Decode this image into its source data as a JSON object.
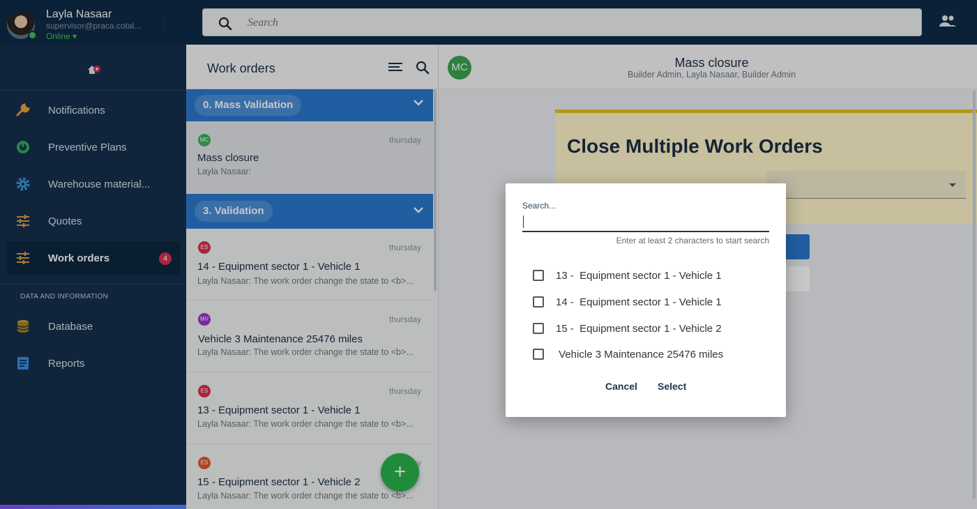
{
  "profile": {
    "name": "Layla Nasaar",
    "email": "supervisor@praca.cotal...",
    "status": "Online ▾"
  },
  "topbar": {
    "search_placeholder": "Search"
  },
  "sidebar": {
    "items": [
      {
        "label": "Notifications",
        "icon": "wrench-icon"
      },
      {
        "label": "Preventive Plans",
        "icon": "gauge-icon"
      },
      {
        "label": "Warehouse material...",
        "icon": "gear-icon"
      },
      {
        "label": "Quotes",
        "icon": "sliders-icon"
      },
      {
        "label": "Work orders",
        "icon": "sliders-icon",
        "badge": "4",
        "active": true
      }
    ],
    "section_title": "DATA AND INFORMATION",
    "section_items": [
      {
        "label": "Database",
        "icon": "database-icon"
      },
      {
        "label": "Reports",
        "icon": "report-icon"
      }
    ]
  },
  "work_orders": {
    "title": "Work orders",
    "groups": [
      {
        "label": "0. Mass Validation"
      },
      {
        "label": "3. Validation"
      }
    ],
    "cards": [
      {
        "initials": "MC",
        "color": "#3fb05a",
        "date": "thursday",
        "title": "Mass closure",
        "subtitle": "Layla Nasaar:"
      },
      {
        "initials": "ES",
        "color": "#d9304f",
        "date": "thursday",
        "title": "14 - Equipment sector 1 - Vehicle 1",
        "subtitle": "Layla Nasaar: The work order change the state to <b>..."
      },
      {
        "initials": "MV",
        "color": "#9b35c9",
        "date": "thursday",
        "title": "Vehicle 3 Maintenance 25476 miles",
        "subtitle": "Layla Nasaar: The work order change the state to <b>..."
      },
      {
        "initials": "ES",
        "color": "#d9304f",
        "date": "thursday",
        "title": "13 - Equipment sector 1 - Vehicle 1",
        "subtitle": "Layla Nasaar: The work order change the state to <b>..."
      },
      {
        "initials": "ES",
        "color": "#e05a2a",
        "date": "thursday",
        "title": "15 - Equipment sector 1 - Vehicle 2",
        "subtitle": "Layla Nasaar: The work order change the state to <b>..."
      }
    ],
    "fab_label": "+"
  },
  "detail": {
    "avatar": "MC",
    "title": "Mass closure",
    "subtitle": "Builder Admin, Layla Nasaar, Builder Admin",
    "panel_title": "Close Multiple Work Orders"
  },
  "dialog": {
    "search_label": "Search...",
    "search_value": "",
    "hint": "Enter at least 2 characters to start search",
    "options": [
      {
        "label": "13 -  Equipment sector 1 - Vehicle 1",
        "checked": false
      },
      {
        "label": "14 -  Equipment sector 1 - Vehicle 1",
        "checked": false
      },
      {
        "label": "15 -  Equipment sector 1 - Vehicle 2",
        "checked": false
      },
      {
        "label": " Vehicle 3 Maintenance 25476 miles",
        "checked": false
      }
    ],
    "cancel_label": "Cancel",
    "select_label": "Select"
  },
  "colors": {
    "sidebar_bg": "#15304d",
    "accent_blue": "#2b79cf",
    "fab_green": "#2bb34d",
    "badge_red": "#d9304f",
    "panel_yellow": "#fff5c9"
  }
}
